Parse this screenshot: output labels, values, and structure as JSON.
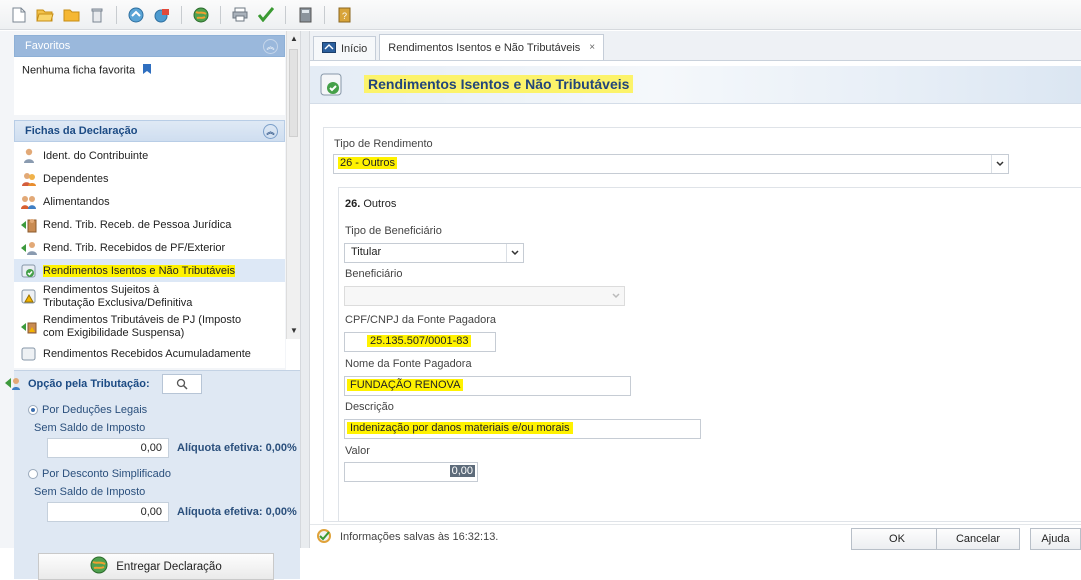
{
  "toolbar": {
    "buttons": [
      "new-file-icon",
      "open-folder-icon",
      "folder-icon",
      "trash-icon",
      "import-icon",
      "transmit-icon",
      "globe-icon",
      "print-icon",
      "check-icon",
      "calculator-icon",
      "help-book-icon"
    ]
  },
  "sidebar": {
    "favoritos_title": "Favoritos",
    "favoritos_empty": "Nenhuma ficha favorita",
    "fichas_title": "Fichas da Declaração",
    "items": [
      {
        "label": "Ident. do Contribuinte",
        "icon": "person-icon"
      },
      {
        "label": "Dependentes",
        "icon": "dependents-icon"
      },
      {
        "label": "Alimentandos",
        "icon": "alimentandos-icon"
      },
      {
        "label": "Rend. Trib. Receb. de Pessoa Jurídica",
        "icon": "company-income-icon"
      },
      {
        "label": "Rend. Trib. Recebidos de PF/Exterior",
        "icon": "person-income-icon"
      },
      {
        "label": "Rendimentos Isentos e Não Tributáveis",
        "icon": "exempt-income-icon"
      },
      {
        "label": "Rendimentos Sujeitos à Tributação Exclusiva/Definitiva",
        "icon": "exclusive-tax-icon"
      },
      {
        "label": "Rendimentos Tributáveis de PJ (Imposto com Exigibilidade Suspensa)",
        "icon": "suspended-tax-icon"
      },
      {
        "label": "Rendimentos Recebidos Acumuladamente",
        "icon": "accumulated-income-icon"
      }
    ]
  },
  "opcao": {
    "title": "Opção pela Tributação:",
    "option1": "Por Deduções Legais",
    "option1_sub": "Sem Saldo de Imposto",
    "option1_value": "0,00",
    "option1_aliquota": "Alíquota efetiva: 0,00%",
    "option2": "Por Desconto Simplificado",
    "option2_sub": "Sem Saldo de Imposto",
    "option2_value": "0,00",
    "option2_aliquota": "Alíquota efetiva: 0,00%",
    "entregar": "Entregar Declaração"
  },
  "tabs": {
    "inicio": "Início",
    "active": "Rendimentos Isentos e Não Tributáveis",
    "close": "×"
  },
  "banner": {
    "title": "Rendimentos Isentos e Não Tributáveis"
  },
  "form": {
    "tipo_label": "Tipo de Rendimento",
    "tipo_value": "26 - Outros",
    "section_num": "26.",
    "section_name": "Outros",
    "tipo_benef_label": "Tipo de Beneficiário",
    "tipo_benef_value": "Titular",
    "beneficiario_label": "Beneficiário",
    "cpf_label": "CPF/CNPJ da Fonte Pagadora",
    "cpf_value": "25.135.507/0001-83",
    "nome_label": "Nome da Fonte Pagadora",
    "nome_value": "FUNDAÇÃO RENOVA",
    "descricao_label": "Descrição",
    "descricao_value": "Indenização por danos materiais e/ou morais",
    "valor_label": "Valor",
    "valor_value": "0,00"
  },
  "status": {
    "text": "Informações salvas às 16:32:13."
  },
  "buttons": {
    "ok": "OK",
    "cancelar": "Cancelar",
    "ajuda": "Ajuda"
  },
  "colors": {
    "highlight": "#fff200",
    "accent": "#22457a",
    "panel": "#dfe8f3"
  }
}
